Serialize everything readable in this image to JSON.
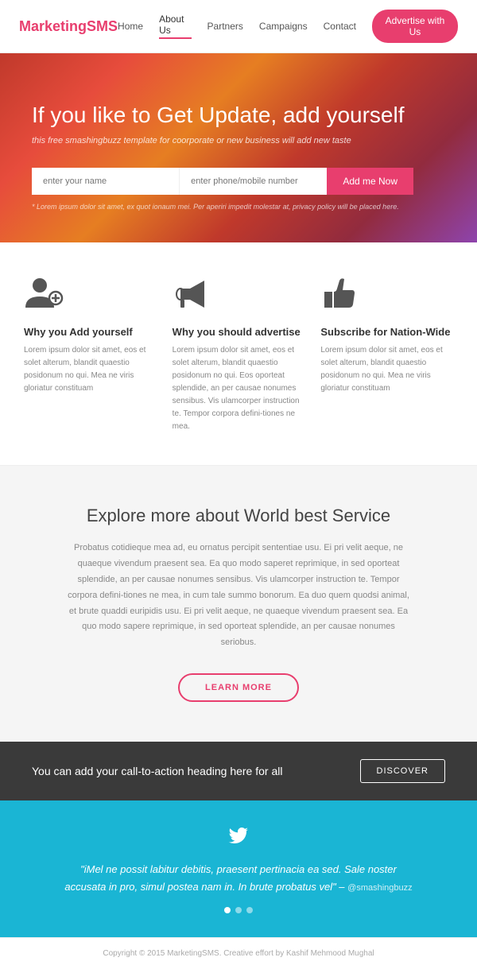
{
  "nav": {
    "logo_text": "Marketing",
    "logo_accent": "SMS",
    "links": [
      {
        "label": "Home",
        "active": false
      },
      {
        "label": "About Us",
        "active": true
      },
      {
        "label": "Partners",
        "active": false
      },
      {
        "label": "Campaigns",
        "active": false
      },
      {
        "label": "Contact",
        "active": false
      }
    ],
    "cta_button": "Advertise with Us"
  },
  "hero": {
    "title": "If you like to Get Update, add yourself",
    "subtitle": "this free smashingbuzz template for coorporate or new business will add new taste",
    "name_placeholder": "enter your name",
    "phone_placeholder": "enter phone/mobile number",
    "button_label": "Add me Now",
    "disclaimer": "* Lorem ipsum dolor sit amet, ex quot ionaum mei. Per aperiri impedit molestar at, privacy policy will be placed here."
  },
  "features": [
    {
      "id": "add-yourself",
      "title": "Why you Add yourself",
      "description": "Lorem ipsum dolor sit amet, eos et solet alterum, blandit quaestio posidonum no qui. Mea ne viris gloriatur constituam"
    },
    {
      "id": "advertise",
      "title": "Why you should advertise",
      "description": "Lorem ipsum dolor sit amet, eos et solet alterum, blandit quaestio posidonum no qui. Eos oporteat splendide, an per causae nonumes sensibus. Vis ulamcorper instruction te. Tempor corpora defini-tiones ne mea."
    },
    {
      "id": "subscribe",
      "title": "Subscribe for Nation-Wide",
      "description": "Lorem ipsum dolor sit amet, eos et solet alterum, blandit quaestio posidonum no qui. Mea ne viris gloriatur constituam"
    }
  ],
  "explore": {
    "heading": "Explore more about World best Service",
    "body": "Probatus cotidieque mea ad, eu ornatus percipit sententiae usu. Ei pri velit aeque, ne quaeque vivendum praesent sea. Ea quo modo saperet reprimique, in sed oporteat splendide, an per causae nonumes sensibus. Vis ulamcorper instruction te. Tempor corpora defini-tiones ne mea, in cum tale summo bonorum. Ea duo quem quodsi animal, et brute quaddi euripidis usu. Ei pri velit aeque, ne quaeque vivendum praesent sea. Ea quo modo sapere reprimique, in sed oporteat splendide, an per causae nonumes seriobus.",
    "button_label": "LEARN MORE"
  },
  "cta_strip": {
    "text": "You can add your call-to-action heading here for all",
    "button_label": "DISCOVER"
  },
  "testimonial": {
    "quote": "\"iMel ne possit labitur debitis, praesent pertinacia ea sed. Sale noster accusata in pro, simul postea nam in. In brute probatus vel\" –",
    "author": "@smashingbuzz",
    "dots": [
      true,
      false,
      false
    ]
  },
  "footer": {
    "text": "Copyright © 2015 MarketingSMS. Creative effort by Kashif Mehmood Mughal"
  }
}
